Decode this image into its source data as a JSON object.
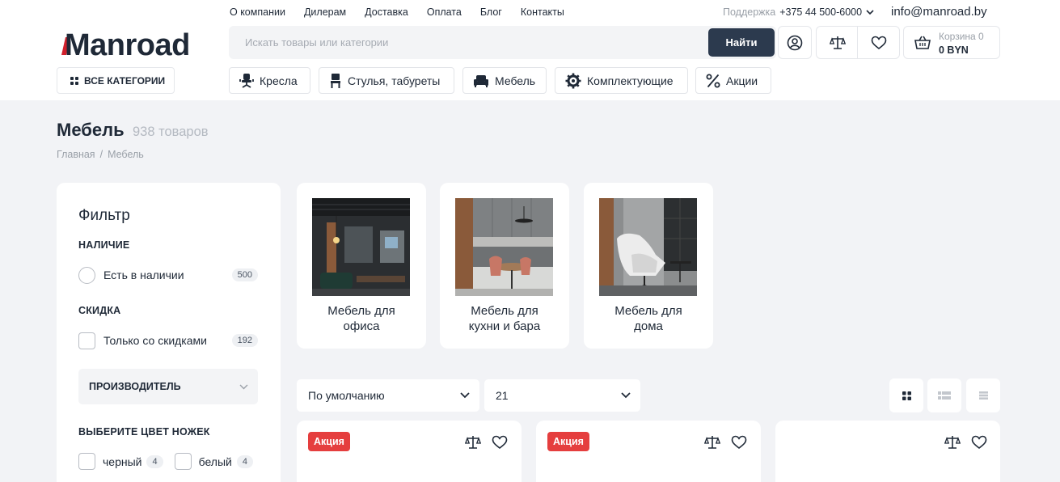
{
  "header": {
    "topnav": [
      "О компании",
      "Дилерам",
      "Доставка",
      "Оплата",
      "Блог",
      "Контакты"
    ],
    "support_label": "Поддержка",
    "phone": "+375 44 500-6000",
    "email": "info@manroad.by",
    "logo_text": "Manroad",
    "search_placeholder": "Искать товары или категории",
    "search_button": "Найти",
    "cart_label": "Корзина 0",
    "cart_total": "0 BYN",
    "all_categories": "ВСЕ КАТЕГОРИИ",
    "categories": [
      "Кресла",
      "Стулья, табуреты",
      "Мебель",
      "Комплектующие",
      "Акции"
    ]
  },
  "page": {
    "title": "Мебель",
    "count": "938 товаров",
    "breadcrumb": [
      "Главная",
      "/",
      "Мебель"
    ]
  },
  "filter": {
    "title": "Фильтр",
    "availability_heading": "НАЛИЧИЕ",
    "in_stock_label": "Есть в наличии",
    "in_stock_count": "500",
    "discount_heading": "СКИДКА",
    "discount_label": "Только со скидками",
    "discount_count": "192",
    "manufacturer_label": "ПРОИЗВОДИТЕЛЬ",
    "leg_color_heading": "ВЫБЕРИТЕ ЦВЕТ НОЖЕК",
    "colors": [
      {
        "label": "черный",
        "count": "4"
      },
      {
        "label": "белый",
        "count": "4"
      }
    ]
  },
  "subcategories": [
    "Мебель для офиса",
    "Мебель для кухни и бара",
    "Мебель для дома"
  ],
  "sorting": {
    "sort_value": "По умолчанию",
    "per_page_value": "21"
  },
  "products": [
    {
      "badge": "Акция"
    },
    {
      "badge": "Акция"
    },
    {
      "badge": ""
    }
  ],
  "colors": {
    "accent_dark": "#2c3a4e",
    "sale_red": "#e53e3e",
    "logo_red": "#d0202c"
  }
}
